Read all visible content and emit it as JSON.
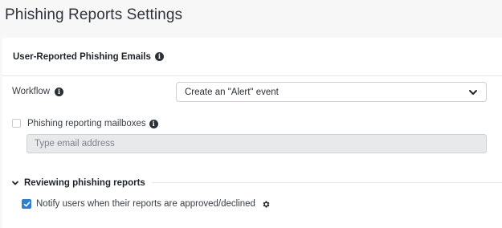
{
  "page": {
    "title": "Phishing Reports Settings"
  },
  "panel": {
    "header_label": "User-Reported Phishing Emails",
    "header_icon": "info-icon"
  },
  "workflow": {
    "label": "Workflow",
    "selected_value": "Create an \"Alert\" event",
    "icon": "info-icon"
  },
  "mailboxes": {
    "label": "Phishing reporting mailboxes",
    "checked": false,
    "input_value": "",
    "input_placeholder": "Type email address"
  },
  "reviewing": {
    "section_title": "Reviewing phishing reports",
    "expanded": true,
    "notify_label": "Notify users when their reports are approved/declined",
    "notify_checked": true,
    "settings_icon": "gear-icon"
  },
  "colors": {
    "accent": "#2f7fd1",
    "input_disabled_bg": "#e8e9eb",
    "page_bg": "#f7f7f8"
  }
}
